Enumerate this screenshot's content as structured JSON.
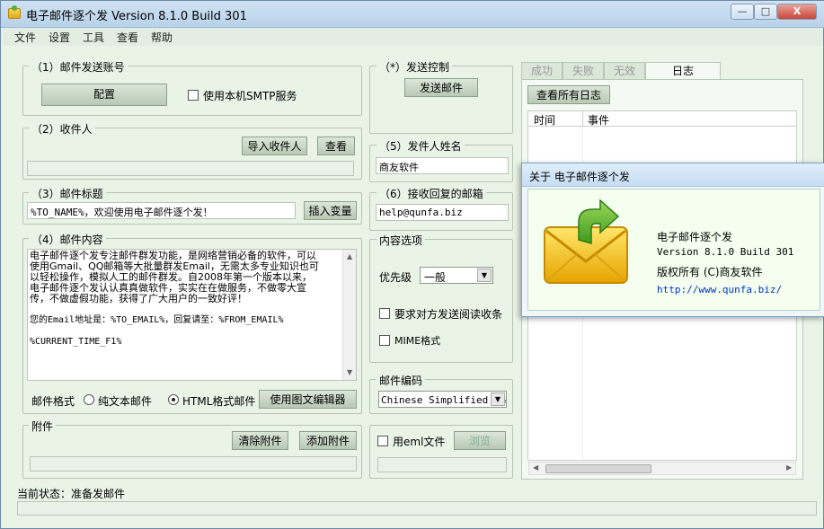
{
  "window": {
    "title": "电子邮件逐个发 Version 8.1.0 Build 301",
    "min": "—",
    "max": "□",
    "close": "X"
  },
  "menu": [
    "文件",
    "设置",
    "工具",
    "查看",
    "帮助"
  ],
  "account": {
    "legend": "（1）邮件发送账号",
    "config_label": "配置",
    "local_smtp_label": "使用本机SMTP服务"
  },
  "recipients": {
    "legend": "（2）收件人",
    "import_label": "导入收件人",
    "view_label": "查看"
  },
  "subject": {
    "legend": "（3）邮件标题",
    "value": "%TO_NAME%，欢迎使用电子邮件逐个发！",
    "insert_label": "插入变量"
  },
  "content": {
    "legend": "（4）邮件内容",
    "line1": "电子邮件逐个发专注邮件群发功能，是网络营销必备的软件，可以",
    "line2": "使用Gmail、QQ邮箱等大批量群发Email，无需太多专业知识也可",
    "line3": "以轻松操作，模拟人工的邮件群发。自2008年第一个版本以来，",
    "line4": "电子邮件逐个发认认真真做软件，实实在在做服务，不做零大宣",
    "line5": "传，不做虚假功能，获得了广大用户的一致好评！",
    "line6": "您的Email地址是：%TO_EMAIL%，回复请至：%FROM_EMAIL%",
    "line7": "%CURRENT_TIME_F1%",
    "format_label": "邮件格式",
    "plain_label": "纯文本邮件",
    "html_label": "HTML格式邮件",
    "editor_label": "使用图文编辑器"
  },
  "attachment": {
    "legend": "附件",
    "clear_label": "清除附件",
    "add_label": "添加附件"
  },
  "send_control": {
    "legend": "（*）发送控制",
    "send_label": "发送邮件"
  },
  "sender": {
    "legend": "（5）发件人姓名",
    "value": "商友软件"
  },
  "reply": {
    "legend": "（6）接收回复的邮箱",
    "value": "help@qunfa.biz"
  },
  "options": {
    "legend": "内容选项",
    "priority_label": "优先级",
    "priority_value": "一般",
    "receipt_label": "要求对方发送阅读收条",
    "mime_label": "MIME格式"
  },
  "encoding": {
    "legend": "邮件编码",
    "value": "Chinese Simplified (G"
  },
  "eml": {
    "use_label": "用eml文件",
    "browse_label": "浏览"
  },
  "tabs": [
    "成功",
    "失败",
    "无效",
    "日志"
  ],
  "log": {
    "view_all_label": "查看所有日志",
    "col_time": "时间",
    "col_event": "事件"
  },
  "about": {
    "title": "关于 电子邮件逐个发",
    "name": "电子邮件逐个发",
    "version": "Version 8.1.0 Build 301",
    "copyright": "版权所有 (C)商友软件",
    "url": "http://www.qunfa.biz/"
  },
  "status": {
    "text": "当前状态：准备发邮件"
  },
  "colors": {
    "bg": "#e9f3e6",
    "button": "#c5d4c2",
    "title": "#c6ddf2"
  }
}
